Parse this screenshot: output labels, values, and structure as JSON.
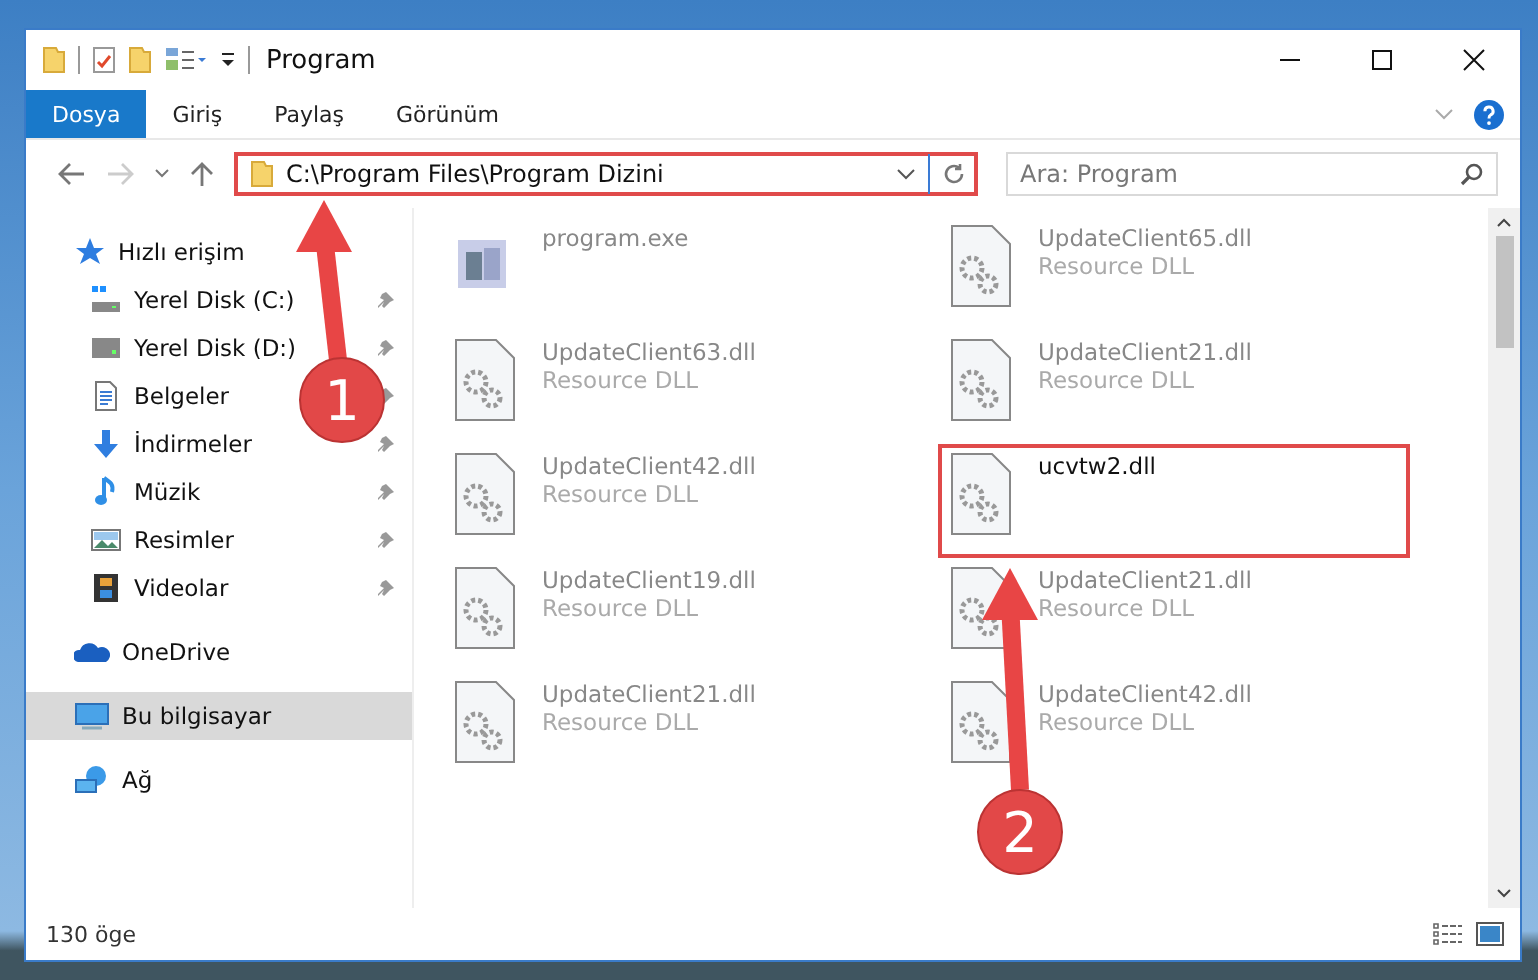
{
  "window": {
    "title": "Program"
  },
  "ribbon_tabs": [
    {
      "label": "Dosya",
      "selected": true
    },
    {
      "label": "Giriş",
      "selected": false
    },
    {
      "label": "Paylaş",
      "selected": false
    },
    {
      "label": "Görünüm",
      "selected": false
    }
  ],
  "address": {
    "path": "C:\\Program Files\\Program Dizini",
    "highlighted": true
  },
  "search": {
    "placeholder": "Ara: Program"
  },
  "nav": [
    {
      "label": "Hızlı erişim",
      "kind": "star",
      "selected": false,
      "children": [
        {
          "label": "Yerel Disk (C:)",
          "kind": "sysdrive",
          "pinned": true,
          "selected": false
        },
        {
          "label": "Yerel Disk (D:)",
          "kind": "drive",
          "pinned": true,
          "selected": false
        },
        {
          "label": "Belgeler",
          "kind": "document",
          "pinned": true,
          "selected": false
        },
        {
          "label": "İndirmeler",
          "kind": "download",
          "pinned": true,
          "selected": false
        },
        {
          "label": "Müzik",
          "kind": "music",
          "pinned": true,
          "selected": false
        },
        {
          "label": "Resimler",
          "kind": "pictures",
          "pinned": true,
          "selected": false
        },
        {
          "label": "Videolar",
          "kind": "video",
          "pinned": true,
          "selected": false
        }
      ]
    },
    {
      "label": "OneDrive",
      "kind": "cloud",
      "selected": false
    },
    {
      "label": "Bu bilgisayar",
      "kind": "computer",
      "selected": true
    },
    {
      "label": "Ağ",
      "kind": "network",
      "selected": false
    }
  ],
  "files": [
    {
      "name": "program.exe",
      "kind": "exe",
      "highlighted": false
    },
    {
      "name": "UpdateClient65.dll",
      "type": "Resource DLL",
      "kind": "dll",
      "highlighted": false
    },
    {
      "name": "UpdateClient63.dll",
      "type": "Resource DLL",
      "kind": "dll",
      "highlighted": false
    },
    {
      "name": "UpdateClient21.dll",
      "type": "Resource DLL",
      "kind": "dll",
      "highlighted": false
    },
    {
      "name": "UpdateClient42.dll",
      "type": "Resource DLL",
      "kind": "dll",
      "highlighted": false
    },
    {
      "name": "ucvtw2.dll",
      "kind": "dll",
      "highlighted": true
    },
    {
      "name": "UpdateClient19.dll",
      "type": "Resource DLL",
      "kind": "dll",
      "highlighted": false
    },
    {
      "name": "UpdateClient21.dll",
      "type": "Resource DLL",
      "kind": "dll",
      "highlighted": false
    },
    {
      "name": "UpdateClient21.dll",
      "type": "Resource DLL",
      "kind": "dll",
      "highlighted": false
    },
    {
      "name": "UpdateClient42.dll",
      "type": "Resource DLL",
      "kind": "dll",
      "highlighted": false
    }
  ],
  "status_bar": {
    "count": "130 öge"
  },
  "annotations": [
    {
      "number": "1"
    },
    {
      "number": "2"
    }
  ]
}
